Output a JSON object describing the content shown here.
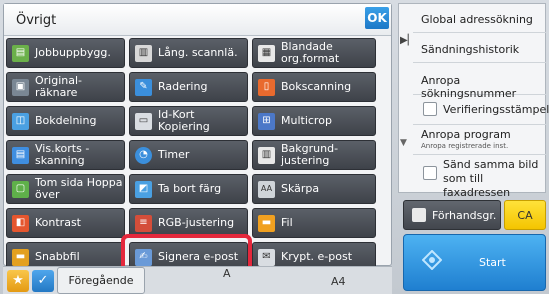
{
  "popup": {
    "title": "Övrigt",
    "ok_label": "OK"
  },
  "functions": [
    {
      "label": "Jobbuppbygg.",
      "icon": "job-build-icon",
      "color": "#6bb04a"
    },
    {
      "label": "Lång. scannlä.",
      "icon": "long-scan-icon",
      "color": "#d8d8d8"
    },
    {
      "label": "Blandade org.format",
      "icon": "mixed-size-icon",
      "color": "#e8e8e8"
    },
    {
      "label": "Original-räknare",
      "icon": "original-counter-icon",
      "color": "#7a8794"
    },
    {
      "label": "Radering",
      "icon": "erase-icon",
      "color": "#3b8fdc"
    },
    {
      "label": "Bokscanning",
      "icon": "book-scan-icon",
      "color": "#e96a2e"
    },
    {
      "label": "Bokdelning",
      "icon": "book-divide-icon",
      "color": "#4aa0e2"
    },
    {
      "label": "Id-Kort Kopiering",
      "icon": "id-card-icon",
      "color": "#d9dde2"
    },
    {
      "label": "Multicrop",
      "icon": "multicrop-icon",
      "color": "#4c78c8"
    },
    {
      "label": "Vis.korts -skanning",
      "icon": "card-scan-icon",
      "color": "#3f8ee0"
    },
    {
      "label": "Timer",
      "icon": "timer-icon",
      "color": "#3b8fdc"
    },
    {
      "label": "Bakgrund-justering",
      "icon": "background-adjust-icon",
      "color": "#e8e8e8"
    },
    {
      "label": "Tom sida Hoppa över",
      "icon": "blank-page-skip-icon",
      "color": "#5fb04a"
    },
    {
      "label": "Ta bort färg",
      "icon": "remove-color-icon",
      "color": "#4aa0e2"
    },
    {
      "label": "Skärpa",
      "icon": "sharpness-icon",
      "color": "#cfd4d9"
    },
    {
      "label": "Kontrast",
      "icon": "contrast-icon",
      "color": "#e5562e"
    },
    {
      "label": "RGB-justering",
      "icon": "rgb-adjust-icon",
      "color": "#d44e3a"
    },
    {
      "label": "Fil",
      "icon": "file-icon",
      "color": "#f0a020"
    },
    {
      "label": "Snabbfil",
      "icon": "quick-file-icon",
      "color": "#e3a020"
    },
    {
      "label": "Signera e-post",
      "icon": "sign-email-icon",
      "color": "#6a9ad8"
    },
    {
      "label": "Krypt. e-post",
      "icon": "encrypt-email-icon",
      "color": "#d9dde2"
    }
  ],
  "bottom": {
    "previous_label": "Föregående",
    "text_a": "A",
    "paper_size": "A4"
  },
  "right_panel": {
    "items": [
      {
        "label": "Global adressökning"
      },
      {
        "label": "Sändningshistorik"
      },
      {
        "label": "Anropa sökningsnummer"
      },
      {
        "label": "Verifieringsstämpel",
        "checkbox": true
      },
      {
        "label": "Anropa program",
        "sub": "Anropa registrerade inst."
      },
      {
        "label": "Sänd samma bild som till faxadressen",
        "checkbox": true
      }
    ]
  },
  "actions": {
    "preview_label": "Förhandsgr.",
    "ca_label": "CA",
    "start_label": "Start"
  },
  "colors": {
    "highlight": "#e4283c",
    "ok": "#1c78c7",
    "start": "#1f7fd0",
    "ca": "#f4c400"
  }
}
